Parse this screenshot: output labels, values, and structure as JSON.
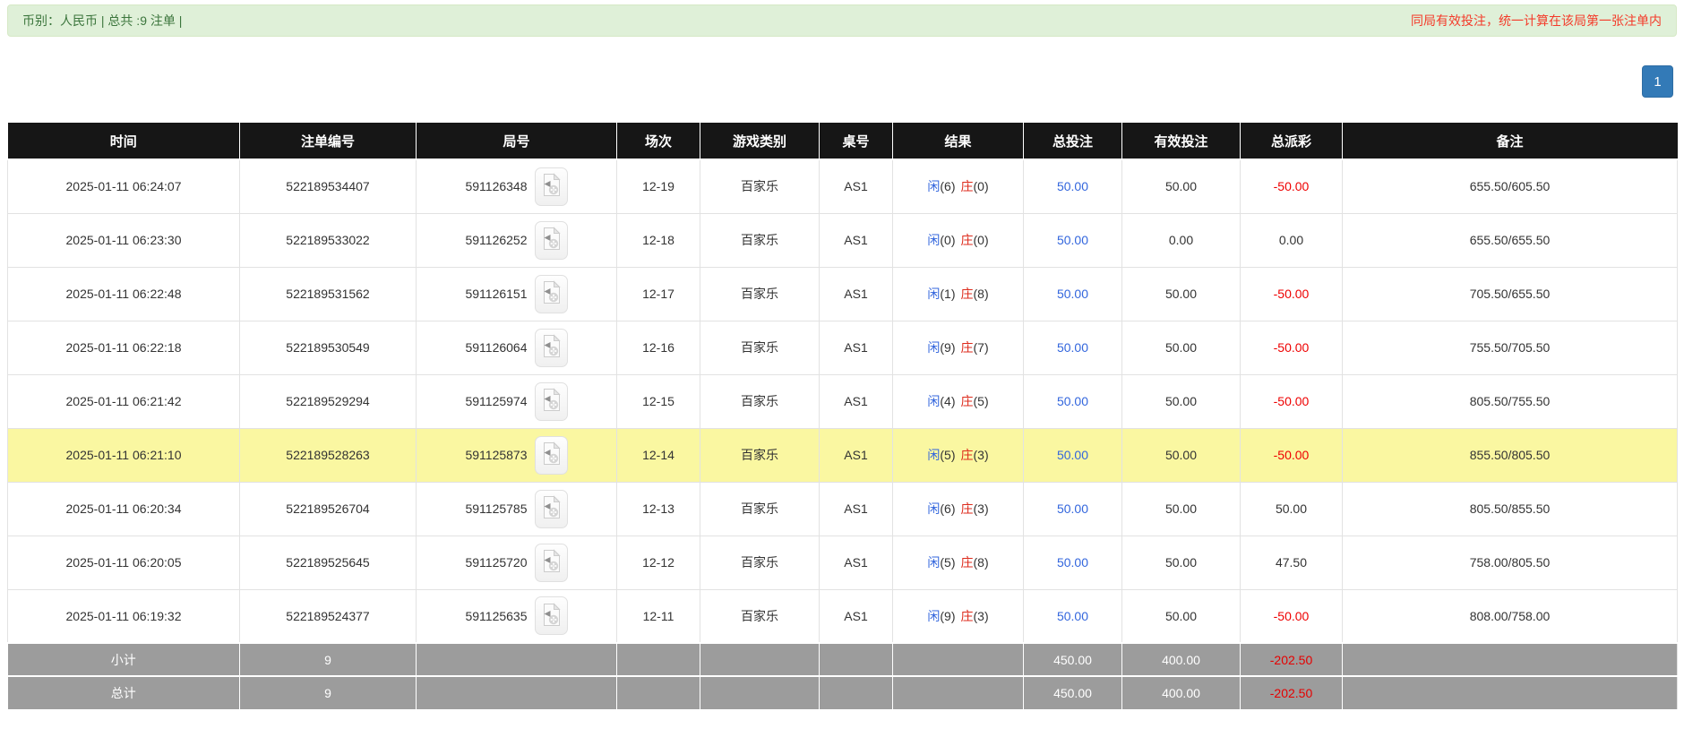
{
  "top_bar": {
    "left_text": "币别：人民币 | 总共 :9 注单 |",
    "right_text": "同局有效投注，统一计算在该局第一张注单内"
  },
  "pagination": {
    "current_page": "1"
  },
  "table": {
    "headers": [
      "时间",
      "注单编号",
      "局号",
      "场次",
      "游戏类别",
      "桌号",
      "结果",
      "总投注",
      "有效投注",
      "总派彩",
      "备注"
    ],
    "result_labels": {
      "player": "闲",
      "banker": "庄"
    },
    "icons": {
      "round_video": "video-file-icon"
    },
    "rows": [
      {
        "time": "2025-01-11 06:24:07",
        "bet_id": "522189534407",
        "round_id": "591126348",
        "session": "12-19",
        "game_type": "百家乐",
        "table_no": "AS1",
        "player_score": "(6)",
        "banker_score": "(0)",
        "total_bet": "50.00",
        "valid_bet": "50.00",
        "payout": "-50.00",
        "remark": "655.50/605.50",
        "highlighted": false
      },
      {
        "time": "2025-01-11 06:23:30",
        "bet_id": "522189533022",
        "round_id": "591126252",
        "session": "12-18",
        "game_type": "百家乐",
        "table_no": "AS1",
        "player_score": "(0)",
        "banker_score": "(0)",
        "total_bet": "50.00",
        "valid_bet": "0.00",
        "payout": "0.00",
        "remark": "655.50/655.50",
        "highlighted": false
      },
      {
        "time": "2025-01-11 06:22:48",
        "bet_id": "522189531562",
        "round_id": "591126151",
        "session": "12-17",
        "game_type": "百家乐",
        "table_no": "AS1",
        "player_score": "(1)",
        "banker_score": "(8)",
        "total_bet": "50.00",
        "valid_bet": "50.00",
        "payout": "-50.00",
        "remark": "705.50/655.50",
        "highlighted": false
      },
      {
        "time": "2025-01-11 06:22:18",
        "bet_id": "522189530549",
        "round_id": "591126064",
        "session": "12-16",
        "game_type": "百家乐",
        "table_no": "AS1",
        "player_score": "(9)",
        "banker_score": "(7)",
        "total_bet": "50.00",
        "valid_bet": "50.00",
        "payout": "-50.00",
        "remark": "755.50/705.50",
        "highlighted": false
      },
      {
        "time": "2025-01-11 06:21:42",
        "bet_id": "522189529294",
        "round_id": "591125974",
        "session": "12-15",
        "game_type": "百家乐",
        "table_no": "AS1",
        "player_score": "(4)",
        "banker_score": "(5)",
        "total_bet": "50.00",
        "valid_bet": "50.00",
        "payout": "-50.00",
        "remark": "805.50/755.50",
        "highlighted": false
      },
      {
        "time": "2025-01-11 06:21:10",
        "bet_id": "522189528263",
        "round_id": "591125873",
        "session": "12-14",
        "game_type": "百家乐",
        "table_no": "AS1",
        "player_score": "(5)",
        "banker_score": "(3)",
        "total_bet": "50.00",
        "valid_bet": "50.00",
        "payout": "-50.00",
        "remark": "855.50/805.50",
        "highlighted": true
      },
      {
        "time": "2025-01-11 06:20:34",
        "bet_id": "522189526704",
        "round_id": "591125785",
        "session": "12-13",
        "game_type": "百家乐",
        "table_no": "AS1",
        "player_score": "(6)",
        "banker_score": "(3)",
        "total_bet": "50.00",
        "valid_bet": "50.00",
        "payout": "50.00",
        "remark": "805.50/855.50",
        "highlighted": false
      },
      {
        "time": "2025-01-11 06:20:05",
        "bet_id": "522189525645",
        "round_id": "591125720",
        "session": "12-12",
        "game_type": "百家乐",
        "table_no": "AS1",
        "player_score": "(5)",
        "banker_score": "(8)",
        "total_bet": "50.00",
        "valid_bet": "50.00",
        "payout": "47.50",
        "remark": "758.00/805.50",
        "highlighted": false
      },
      {
        "time": "2025-01-11 06:19:32",
        "bet_id": "522189524377",
        "round_id": "591125635",
        "session": "12-11",
        "game_type": "百家乐",
        "table_no": "AS1",
        "player_score": "(9)",
        "banker_score": "(3)",
        "total_bet": "50.00",
        "valid_bet": "50.00",
        "payout": "-50.00",
        "remark": "808.00/758.00",
        "highlighted": false
      }
    ],
    "footer_rows": [
      {
        "label": "小计",
        "count": "9",
        "total_bet": "450.00",
        "valid_bet": "400.00",
        "payout": "-202.50"
      },
      {
        "label": "总计",
        "count": "9",
        "total_bet": "450.00",
        "valid_bet": "400.00",
        "payout": "-202.50"
      }
    ]
  },
  "colors": {
    "alert_bg": "#dff0d8",
    "alert_text": "#3c763d",
    "alert_warning_text": "#f43b2a",
    "header_bg": "#161616",
    "highlight_yellow": "#faf7a1",
    "footer_gray": "#9c9c9c",
    "player_blue": "#3366dd",
    "banker_red": "#dd2a1b",
    "negative_red": "#ee0000",
    "pager_blue": "#337ab7"
  }
}
